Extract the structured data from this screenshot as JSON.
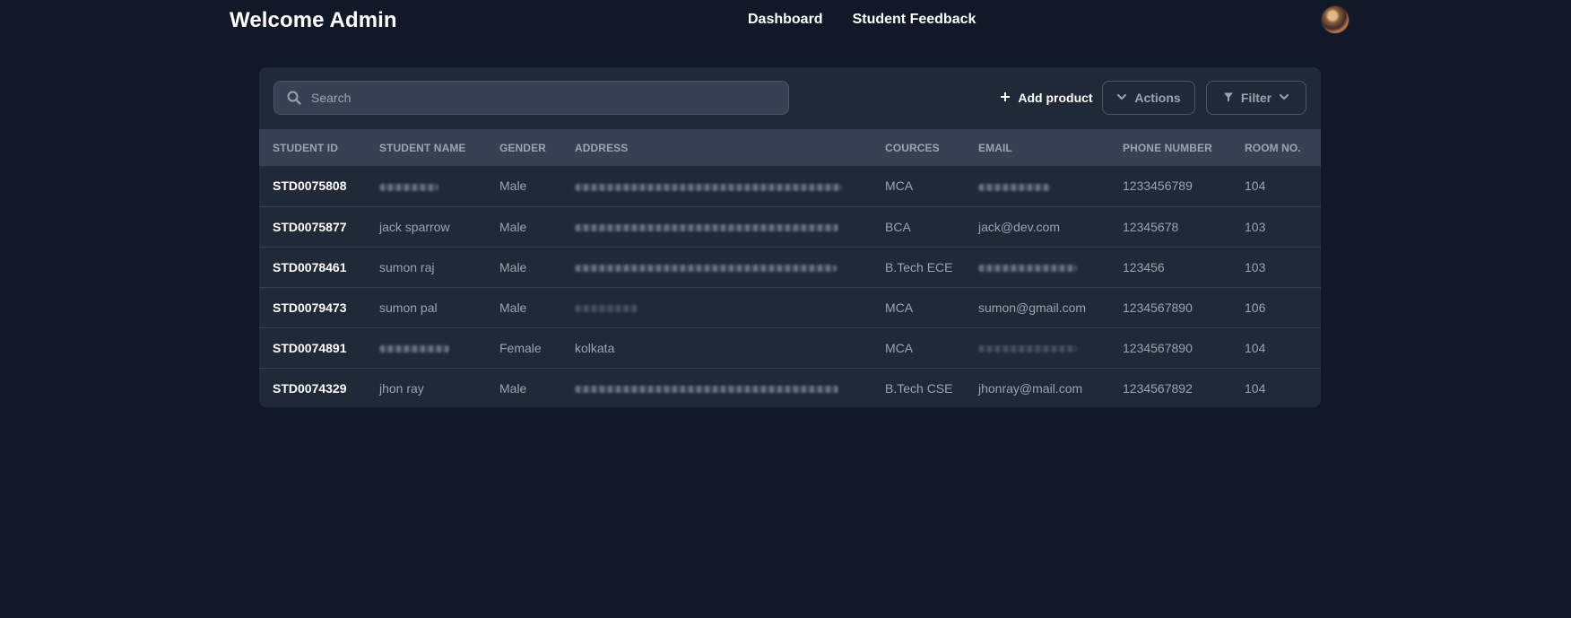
{
  "header": {
    "title": "Welcome Admin",
    "nav": [
      "Dashboard",
      "Student Feedback"
    ],
    "avatar_icon": "user-avatar"
  },
  "toolbar": {
    "search_placeholder": "Search",
    "add_label": "Add product",
    "actions_label": "Actions",
    "filter_label": "Filter"
  },
  "table": {
    "columns": [
      "STUDENT ID",
      "STUDENT NAME",
      "GENDER",
      "ADDRESS",
      "COURCES",
      "EMAIL",
      "PHONE NUMBER",
      "ROOM NO."
    ],
    "rows": [
      {
        "id": "STD0075808",
        "name": "",
        "gender": "Male",
        "address": "",
        "course": "MCA",
        "email": "",
        "phone": "1233456789",
        "room": "104"
      },
      {
        "id": "STD0075877",
        "name": "jack sparrow",
        "gender": "Male",
        "address": "",
        "course": "BCA",
        "email": "jack@dev.com",
        "phone": "12345678",
        "room": "103"
      },
      {
        "id": "STD0078461",
        "name": "sumon raj",
        "gender": "Male",
        "address": "",
        "course": "B.Tech ECE",
        "email": "",
        "phone": "123456",
        "room": "103"
      },
      {
        "id": "STD0079473",
        "name": "sumon pal",
        "gender": "Male",
        "address": "",
        "course": "MCA",
        "email": "sumon@gmail.com",
        "phone": "1234567890",
        "room": "106"
      },
      {
        "id": "STD0074891",
        "name": "",
        "gender": "Female",
        "address": "kolkata",
        "course": "MCA",
        "email": "",
        "phone": "1234567890",
        "room": "104"
      },
      {
        "id": "STD0074329",
        "name": "jhon ray",
        "gender": "Male",
        "address": "",
        "course": "B.Tech CSE",
        "email": "jhonray@mail.com",
        "phone": "1234567892",
        "room": "104"
      }
    ]
  }
}
